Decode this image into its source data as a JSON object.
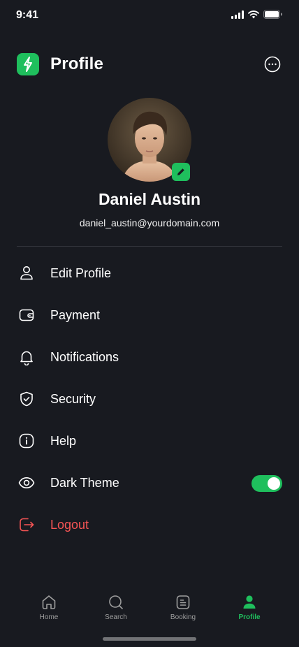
{
  "status_bar": {
    "time": "9:41"
  },
  "header": {
    "title": "Profile"
  },
  "profile": {
    "name": "Daniel Austin",
    "email": "daniel_austin@yourdomain.com"
  },
  "menu": {
    "items": [
      {
        "label": "Edit Profile",
        "icon": "user-icon"
      },
      {
        "label": "Payment",
        "icon": "wallet-icon"
      },
      {
        "label": "Notifications",
        "icon": "bell-icon"
      },
      {
        "label": "Security",
        "icon": "shield-icon"
      },
      {
        "label": "Help",
        "icon": "info-icon"
      },
      {
        "label": "Dark Theme",
        "icon": "eye-icon",
        "toggle": true
      },
      {
        "label": "Logout",
        "icon": "logout-icon"
      }
    ]
  },
  "bottom_nav": {
    "items": [
      {
        "label": "Home",
        "icon": "home-icon"
      },
      {
        "label": "Search",
        "icon": "search-icon"
      },
      {
        "label": "Booking",
        "icon": "document-icon"
      },
      {
        "label": "Profile",
        "icon": "person-icon",
        "active": true
      }
    ]
  },
  "colors": {
    "accent": "#1fbf5d",
    "danger": "#f75555",
    "background": "#181a20"
  }
}
